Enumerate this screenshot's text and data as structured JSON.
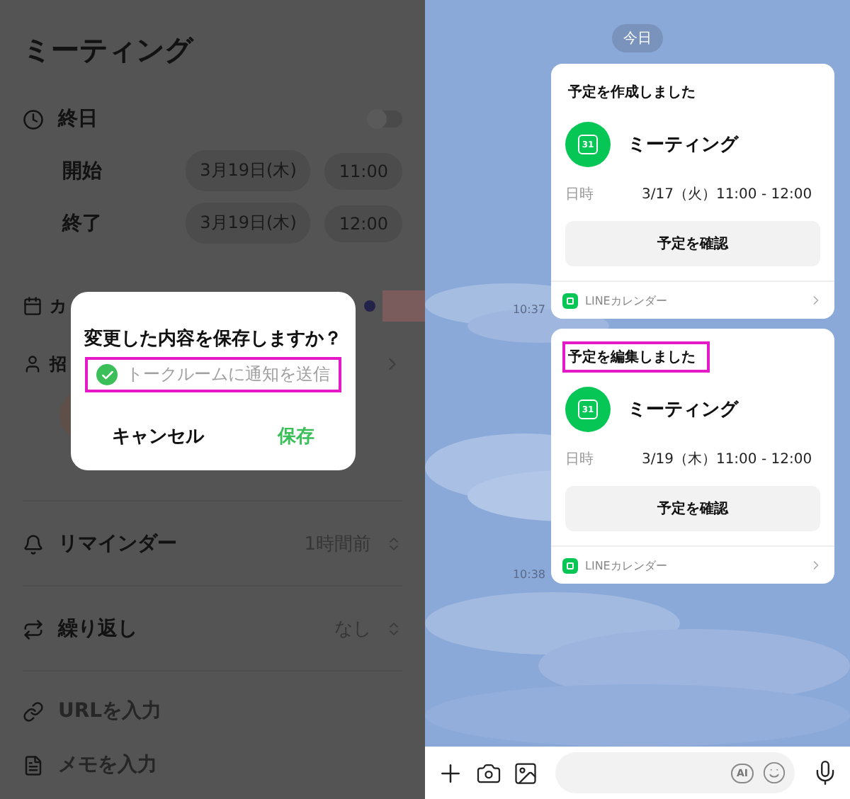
{
  "form": {
    "title": "ミーティング",
    "all_day": {
      "label": "終日",
      "on": false
    },
    "times": [
      {
        "label": "開始",
        "date": "3月19日(木)",
        "time": "11:00"
      },
      {
        "label": "終了",
        "date": "3月19日(木)",
        "time": "12:00"
      }
    ],
    "calendar_label": "カ",
    "invite_label": "招",
    "settings": [
      {
        "kind": "reminder",
        "label": "リマインダー",
        "value": "1時間前"
      },
      {
        "kind": "repeat",
        "label": "繰り返し",
        "value": "なし"
      }
    ],
    "inputs": [
      {
        "kind": "url",
        "placeholder": "URLを入力"
      },
      {
        "kind": "memo",
        "placeholder": "メモを入力"
      }
    ]
  },
  "dialog": {
    "title": "変更した内容を保存しますか？",
    "option": {
      "label": "トークルームに通知を送信",
      "checked": true,
      "highlighted": true
    },
    "buttons": [
      {
        "label": "キャンセル",
        "primary": false
      },
      {
        "label": "保存",
        "primary": true
      }
    ]
  },
  "chat": {
    "date_chip": "今日",
    "messages": [
      {
        "time": "10:37",
        "title": "予定を作成しました",
        "title_highlighted": false,
        "event": "ミーティング",
        "icon_label": "31",
        "date_label": "日時",
        "date_value": "3/17（火）11:00 - 12:00",
        "button": "予定を確認",
        "footer": "LINEカレンダー"
      },
      {
        "time": "10:38",
        "title": "予定を編集しました",
        "title_highlighted": true,
        "event": "ミーティング",
        "icon_label": "31",
        "date_label": "日時",
        "date_value": "3/19（木）11:00 - 12:00",
        "button": "予定を確認",
        "footer": "LINEカレンダー"
      }
    ]
  },
  "composer": {
    "ai_label": "AI"
  }
}
